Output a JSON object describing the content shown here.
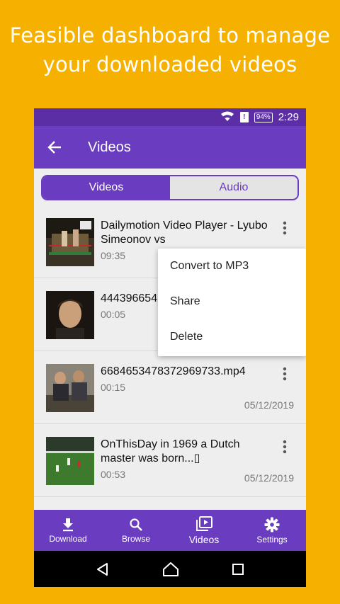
{
  "promo": {
    "line1": "Feasible dashboard to manage",
    "line2": "your downloaded videos"
  },
  "status_bar": {
    "battery": "94%",
    "time": "2:29"
  },
  "app_bar": {
    "title": "Videos"
  },
  "tabs": [
    {
      "label": "Videos",
      "active": true
    },
    {
      "label": "Audio",
      "active": false
    }
  ],
  "videos": [
    {
      "title": "Dailymotion Video Player - Lyubo Simeonov vs",
      "duration": "09:35",
      "date": ""
    },
    {
      "title": "4443966542",
      "duration": "00:05",
      "date": ""
    },
    {
      "title": "6684653478372969733.mp4",
      "duration": "00:15",
      "date": "05/12/2019"
    },
    {
      "title": "OnThisDay in 1969 a Dutch master was born...▯",
      "duration": "00:53",
      "date": "05/12/2019"
    }
  ],
  "context_menu": {
    "items": [
      "Convert to MP3",
      "Share",
      "Delete"
    ]
  },
  "bottom_nav": [
    {
      "label": "Download",
      "icon": "download-icon"
    },
    {
      "label": "Browse",
      "icon": "search-icon"
    },
    {
      "label": "Videos",
      "icon": "video-library-icon",
      "active": true
    },
    {
      "label": "Settings",
      "icon": "gear-icon"
    }
  ],
  "colors": {
    "background": "#F5B000",
    "primary": "#6A3CBF",
    "status_bar": "#5B2EA6"
  }
}
